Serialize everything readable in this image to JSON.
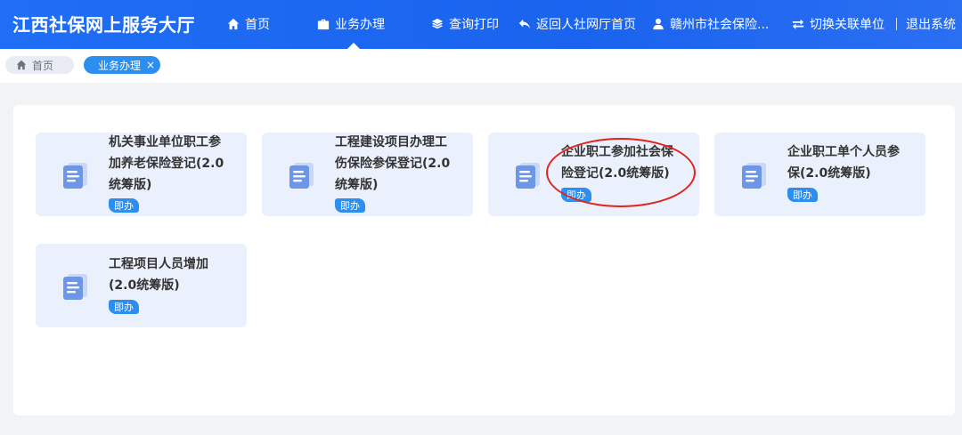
{
  "header": {
    "brand": "江西社保网上服务大厅",
    "nav": [
      {
        "label": "首页",
        "icon": "home-icon"
      },
      {
        "label": "业务办理",
        "icon": "briefcase-icon",
        "active": true
      },
      {
        "label": "查询打印",
        "icon": "layers-icon"
      },
      {
        "label": "返回人社网厅首页",
        "icon": "back-arrow-icon"
      },
      {
        "label": "赣州市社会保险...",
        "icon": "user-icon"
      },
      {
        "label": "切换关联单位",
        "icon": "swap-icon"
      }
    ],
    "logout": "退出系统"
  },
  "tabs": {
    "home": "首页",
    "active": "业务办理",
    "close": "×"
  },
  "cards": [
    {
      "title": "机关事业单位职工参\n加养老保险登记(2.0\n统筹版)",
      "badge": "即办"
    },
    {
      "title": "工程建设项目办理工\n伤保险参保登记(2.0\n统筹版)",
      "badge": "即办"
    },
    {
      "title": "企业职工参加社会保\n险登记(2.0统筹版)",
      "badge": "即办",
      "highlighted": true
    },
    {
      "title": "企业职工单个人员参\n保(2.0统筹版)",
      "badge": "即办"
    },
    {
      "title": "工程项目人员增加\n(2.0统筹版)",
      "badge": "即办"
    }
  ],
  "colors": {
    "header_blue": "#1f6ef5",
    "card_bg": "#ebf1fc",
    "badge_blue": "#2c8ff0",
    "highlight_red": "#e0241b"
  }
}
